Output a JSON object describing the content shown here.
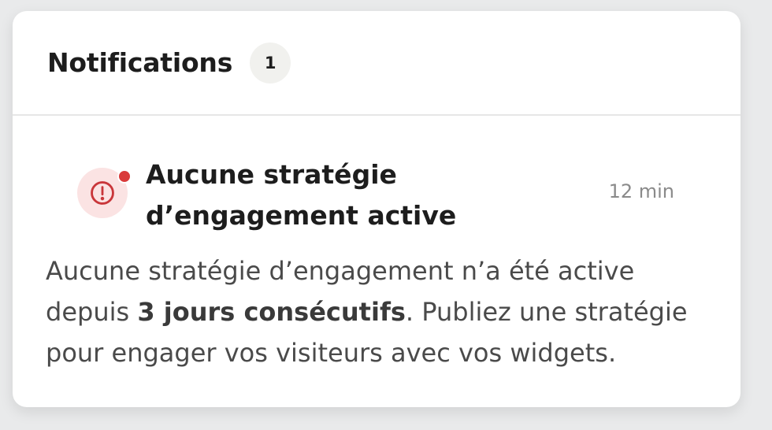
{
  "notifications": {
    "title": "Notifications",
    "count": "1",
    "items": [
      {
        "icon": "alert-circle-icon",
        "unread": true,
        "title": "Aucune stratégie d’engagement active",
        "time": "12 min",
        "body_before": "Aucune stratégie d’engagement n’a été active depuis ",
        "body_bold": "3 jours consécutifs",
        "body_after": ". Publiez une stratégie pour engager vos visiteurs avec vos widgets."
      }
    ]
  },
  "colors": {
    "accent_red": "#d93a3a",
    "icon_bg": "#fbe3e3",
    "badge_bg": "#f1f1ee"
  }
}
